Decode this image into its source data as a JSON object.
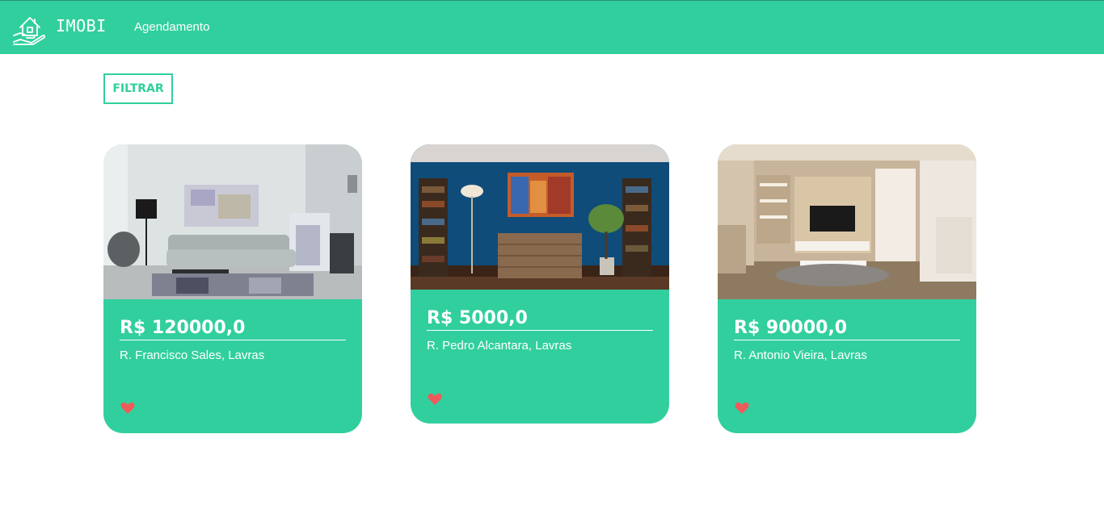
{
  "header": {
    "brand": "IMOBI",
    "nav": {
      "agendamento": "Agendamento"
    },
    "logo_icon": "house-in-hand-icon"
  },
  "filter": {
    "label": "FILTRAR"
  },
  "colors": {
    "accent": "#31cf9e",
    "heart": "#f05a5a",
    "text_on_accent": "#ffffff"
  },
  "listings": [
    {
      "price": "R$ 120000,0",
      "address": "R. Francisco Sales, Lavras",
      "photo": "living-room-photo",
      "favorite_icon": "heart-icon"
    },
    {
      "price": "R$ 5000,0",
      "address": "R. Pedro Alcantara, Lavras",
      "photo": "blue-wall-room-photo",
      "favorite_icon": "heart-icon"
    },
    {
      "price": "R$ 90000,0",
      "address": "R. Antonio Vieira, Lavras",
      "photo": "tv-room-photo",
      "favorite_icon": "heart-icon"
    }
  ]
}
